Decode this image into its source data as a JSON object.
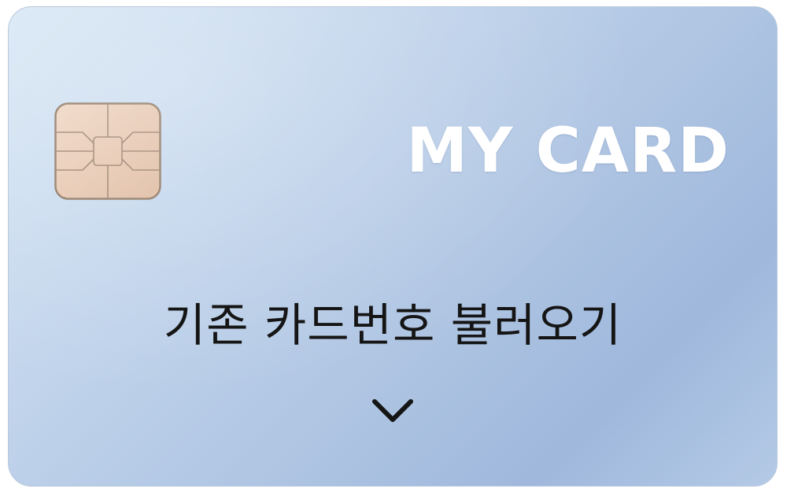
{
  "card": {
    "title": "MY CARD",
    "load_label": "기존 카드번호 불러오기",
    "chip_icon": "card-chip-icon",
    "expand_icon": "chevron-down-icon"
  },
  "colors": {
    "card_gradient_start": "#d6e6f4",
    "card_gradient_end": "#9fb8dc",
    "title": "#ffffff",
    "label": "#151515",
    "chip_fill": "#e8c8b0",
    "chip_border": "#8c7560"
  }
}
